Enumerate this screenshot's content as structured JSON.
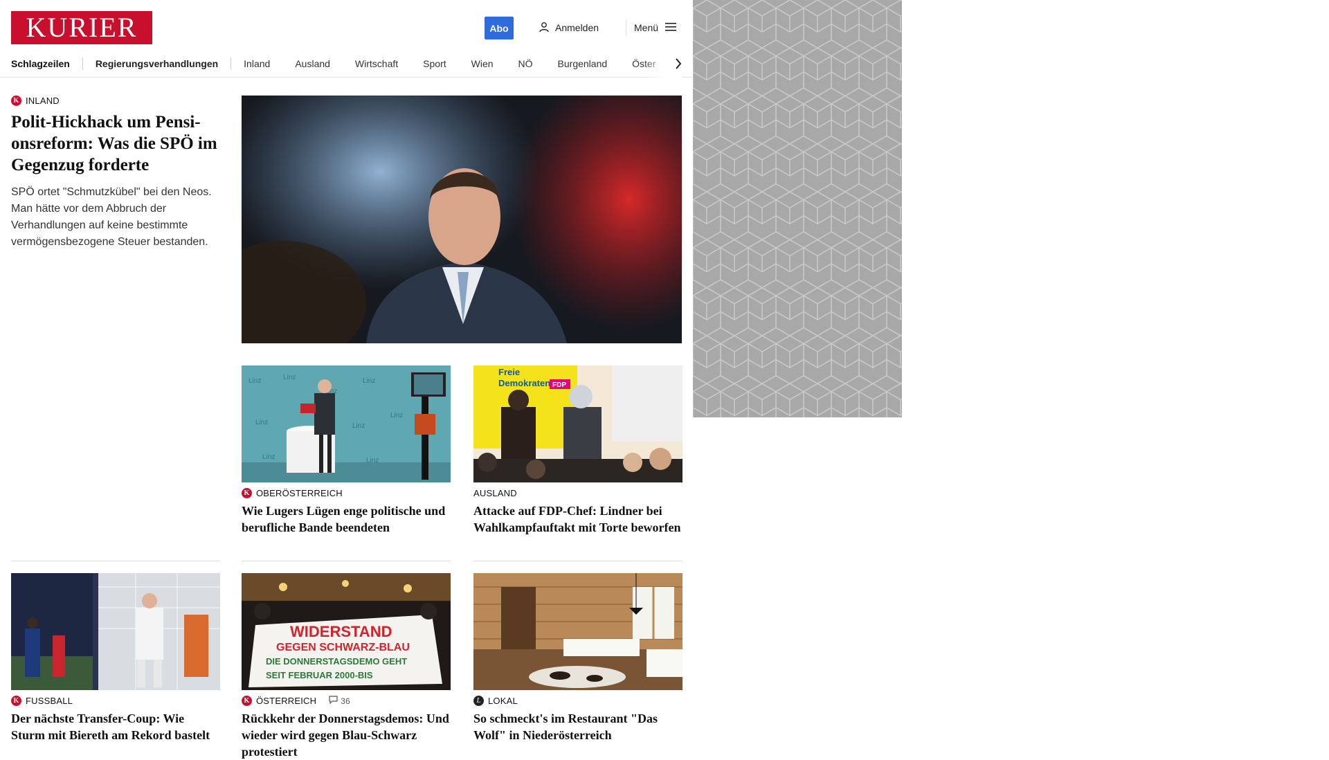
{
  "header": {
    "logo_text": "KURIER",
    "abo_label": "Abo",
    "login_label": "Anmelden",
    "menu_label": "Menü",
    "brand_color": "#c8102e",
    "abo_color": "#2f6bdc"
  },
  "nav": {
    "items": [
      "Schlagzeilen",
      "Regierungsverhandlungen",
      "Inland",
      "Ausland",
      "Wirtschaft",
      "Sport",
      "Wien",
      "NÖ",
      "Burgenland",
      "Öster"
    ]
  },
  "lead_article": {
    "category": "INLAND",
    "headline": "Polit-Hickhack um Pensi­onsreform: Was die SPÖ im Gegenzug forderte",
    "teaser": "SPÖ ortet \"Schmutzkübel\" bei den Neos. Man hätte vor dem Abbruch der Verhandlungen auf keine bestimmte vermögensbezogene Steuer bestanden."
  },
  "articles": [
    {
      "category": "OBERÖSTERREICH",
      "badge": "k",
      "headline": "Wie Lugers Lügen enge politische und berufliche Bande beendeten"
    },
    {
      "category": "AUSLAND",
      "badge": "",
      "headline": "Attacke auf FDP-Chef: Lindner bei Wahlkampfauftakt mit Torte beworfen"
    },
    {
      "category": "FUSSBALL",
      "badge": "k",
      "headline": "Der nächste Transfer-Coup: Wie Sturm mit Biereth am Rekord bastelt"
    },
    {
      "category": "ÖSTERREICH",
      "badge": "k",
      "comments": "36",
      "headline": "Rückkehr der Donnerstagsdemos: Und wieder wird gegen Blau-Schwarz protestiert"
    },
    {
      "category": "LOKAL",
      "badge": "lokal",
      "headline": "So schmeckt's im Restaurant \"Das Wolf\" in Niederösterreich"
    }
  ],
  "image_texts": {
    "linz_backdrop": "Linz",
    "fdp_banner_1": "Freie",
    "fdp_banner_2": "Demokraten",
    "fdp_logo": "FDP",
    "demo_banner_1": "WIDERSTAND",
    "demo_banner_2": "GEGEN SCHWARZ-BLAU",
    "demo_banner_3": "DIE DONNERSTAGSDEMO GEHT",
    "demo_banner_4": "SEIT FEBRUAR 2000-BIS"
  }
}
